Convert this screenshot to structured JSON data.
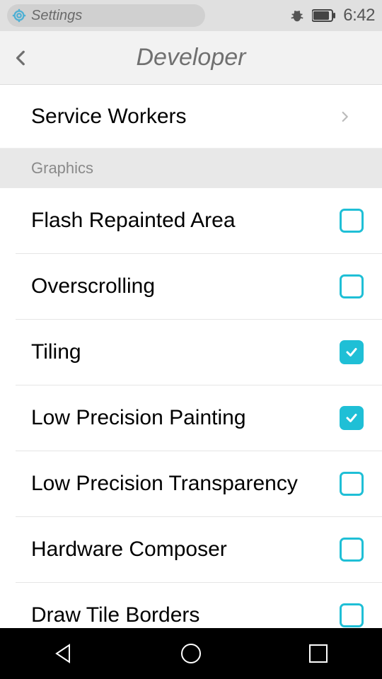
{
  "status": {
    "pill_text": "Settings",
    "time": "6:42"
  },
  "header": {
    "title": "Developer"
  },
  "nav_item": {
    "label": "Service Workers"
  },
  "section": {
    "graphics": "Graphics"
  },
  "items": [
    {
      "label": "Flash Repainted Area",
      "checked": false
    },
    {
      "label": "Overscrolling",
      "checked": false
    },
    {
      "label": "Tiling",
      "checked": true
    },
    {
      "label": "Low Precision Painting",
      "checked": true
    },
    {
      "label": "Low Precision Transparency",
      "checked": false
    },
    {
      "label": "Hardware Composer",
      "checked": false
    },
    {
      "label": "Draw Tile Borders",
      "checked": false
    }
  ],
  "colors": {
    "accent": "#1fbfd6"
  }
}
